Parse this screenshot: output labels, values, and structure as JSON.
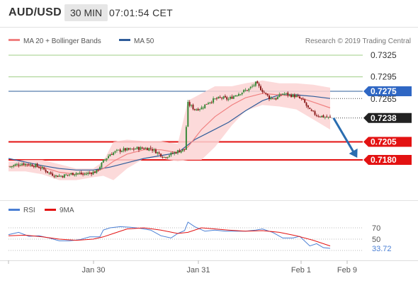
{
  "header": {
    "pair": "AUD/USD",
    "timeframe": "30 MIN",
    "time": "07:01:54 CET"
  },
  "legend": {
    "ma20_label": "MA 20 + Bollinger Bands",
    "ma50_label": "MA 50",
    "credit": "Research © 2019 Trading Central"
  },
  "rsi_legend": {
    "rsi_label": "RSI",
    "ma_label": "9MA"
  },
  "colors": {
    "bullish": "#3a8a3a",
    "bearish": "#8b1c1c",
    "ma20": "#f08080",
    "band_fill": "#fbd3d3",
    "ma50": "#2e5c9a",
    "support": "#e31212",
    "resistance": "#9fce84",
    "arrow": "#2a6db0",
    "rsi": "#4a7fd4",
    "rsi_ma": "#e31212"
  },
  "chart_data": [
    {
      "type": "candlestick",
      "title": "AUD/USD 30 MIN",
      "x_ticks": [
        "Jan 30",
        "Jan 31",
        "Feb 1",
        "Feb 9"
      ],
      "ylim": [
        7145,
        7338
      ],
      "levels": [
        {
          "label": "0.7325",
          "value": 7325,
          "kind": "resistance"
        },
        {
          "label": "0.7295",
          "value": 7295,
          "kind": "resistance"
        },
        {
          "label": "0.7275",
          "value": 7275,
          "kind": "ma50-marker"
        },
        {
          "label": "0.7265",
          "value": 7265,
          "kind": "dotted"
        },
        {
          "label": "0.7238",
          "value": 7238,
          "kind": "last-price"
        },
        {
          "label": "0.7205",
          "value": 7205,
          "kind": "support"
        },
        {
          "label": "0.7180",
          "value": 7180,
          "kind": "support"
        }
      ],
      "close_path": [
        [
          0,
          7170
        ],
        [
          4,
          7173
        ],
        [
          8,
          7175
        ],
        [
          12,
          7174
        ],
        [
          16,
          7172
        ],
        [
          20,
          7168
        ],
        [
          24,
          7162
        ],
        [
          28,
          7158
        ],
        [
          32,
          7158
        ],
        [
          36,
          7160
        ],
        [
          40,
          7162
        ],
        [
          44,
          7160
        ],
        [
          48,
          7162
        ],
        [
          52,
          7164
        ],
        [
          56,
          7178
        ],
        [
          60,
          7188
        ],
        [
          64,
          7192
        ],
        [
          68,
          7194
        ],
        [
          72,
          7194
        ],
        [
          76,
          7196
        ],
        [
          80,
          7196
        ],
        [
          84,
          7196
        ],
        [
          88,
          7190
        ],
        [
          92,
          7184
        ],
        [
          96,
          7188
        ],
        [
          100,
          7192
        ],
        [
          104,
          7194
        ],
        [
          106,
          7258
        ],
        [
          110,
          7250
        ],
        [
          114,
          7252
        ],
        [
          118,
          7260
        ],
        [
          122,
          7264
        ],
        [
          126,
          7266
        ],
        [
          130,
          7264
        ],
        [
          134,
          7270
        ],
        [
          138,
          7274
        ],
        [
          142,
          7278
        ],
        [
          146,
          7286
        ],
        [
          150,
          7276
        ],
        [
          154,
          7266
        ],
        [
          158,
          7265
        ],
        [
          162,
          7272
        ],
        [
          166,
          7270
        ],
        [
          170,
          7268
        ],
        [
          174,
          7262
        ],
        [
          178,
          7248
        ],
        [
          182,
          7242
        ],
        [
          186,
          7240
        ],
        [
          190,
          7238
        ]
      ],
      "ma20_path": [
        [
          0,
          7171
        ],
        [
          10,
          7172
        ],
        [
          20,
          7170
        ],
        [
          30,
          7163
        ],
        [
          40,
          7160
        ],
        [
          50,
          7162
        ],
        [
          56,
          7168
        ],
        [
          62,
          7178
        ],
        [
          70,
          7188
        ],
        [
          80,
          7194
        ],
        [
          90,
          7194
        ],
        [
          100,
          7190
        ],
        [
          106,
          7198
        ],
        [
          114,
          7222
        ],
        [
          122,
          7240
        ],
        [
          132,
          7256
        ],
        [
          140,
          7266
        ],
        [
          150,
          7272
        ],
        [
          160,
          7270
        ],
        [
          170,
          7268
        ],
        [
          180,
          7260
        ],
        [
          190,
          7252
        ]
      ],
      "band_upper": [
        [
          0,
          7178
        ],
        [
          10,
          7180
        ],
        [
          20,
          7180
        ],
        [
          30,
          7174
        ],
        [
          40,
          7168
        ],
        [
          50,
          7168
        ],
        [
          56,
          7178
        ],
        [
          62,
          7205
        ],
        [
          70,
          7208
        ],
        [
          80,
          7206
        ],
        [
          90,
          7206
        ],
        [
          100,
          7202
        ],
        [
          106,
          7262
        ],
        [
          114,
          7272
        ],
        [
          122,
          7282
        ],
        [
          132,
          7282
        ],
        [
          140,
          7286
        ],
        [
          150,
          7290
        ],
        [
          160,
          7286
        ],
        [
          170,
          7286
        ],
        [
          180,
          7284
        ],
        [
          190,
          7280
        ]
      ],
      "band_lower": [
        [
          0,
          7164
        ],
        [
          10,
          7164
        ],
        [
          20,
          7160
        ],
        [
          30,
          7152
        ],
        [
          40,
          7152
        ],
        [
          50,
          7156
        ],
        [
          56,
          7158
        ],
        [
          62,
          7152
        ],
        [
          70,
          7168
        ],
        [
          80,
          7182
        ],
        [
          90,
          7182
        ],
        [
          100,
          7178
        ],
        [
          106,
          7180
        ],
        [
          114,
          7180
        ],
        [
          122,
          7198
        ],
        [
          132,
          7228
        ],
        [
          140,
          7248
        ],
        [
          150,
          7256
        ],
        [
          160,
          7254
        ],
        [
          170,
          7250
        ],
        [
          180,
          7236
        ],
        [
          190,
          7222
        ]
      ],
      "ma50_path": [
        [
          0,
          7182
        ],
        [
          10,
          7177
        ],
        [
          20,
          7172
        ],
        [
          30,
          7168
        ],
        [
          40,
          7166
        ],
        [
          50,
          7166
        ],
        [
          60,
          7170
        ],
        [
          70,
          7176
        ],
        [
          80,
          7182
        ],
        [
          90,
          7186
        ],
        [
          100,
          7190
        ],
        [
          110,
          7208
        ],
        [
          120,
          7220
        ],
        [
          130,
          7232
        ],
        [
          140,
          7248
        ],
        [
          150,
          7262
        ],
        [
          160,
          7270
        ],
        [
          170,
          7270
        ],
        [
          180,
          7268
        ],
        [
          190,
          7265
        ]
      ],
      "forecast_arrow": {
        "from": [
          192,
          7238
        ],
        "to": [
          206,
          7183
        ]
      }
    },
    {
      "type": "line",
      "title": "RSI",
      "ylim": [
        20,
        80
      ],
      "levels": [
        70,
        50,
        30
      ],
      "level_labels": [
        "70",
        "50"
      ],
      "current_label": "33.72",
      "series": [
        {
          "name": "RSI",
          "x": [
            0,
            6,
            12,
            18,
            24,
            30,
            36,
            42,
            48,
            54,
            56,
            60,
            66,
            72,
            78,
            84,
            90,
            96,
            100,
            104,
            106,
            110,
            116,
            122,
            128,
            134,
            140,
            146,
            150,
            156,
            162,
            168,
            172,
            178,
            182,
            186,
            190
          ],
          "values": [
            58,
            62,
            55,
            56,
            52,
            47,
            47,
            49,
            54,
            54,
            66,
            70,
            72,
            71,
            69,
            66,
            56,
            52,
            60,
            65,
            80,
            72,
            64,
            66,
            64,
            64,
            64,
            66,
            68,
            62,
            52,
            52,
            55,
            38,
            42,
            35,
            33.72
          ]
        },
        {
          "name": "9MA",
          "x": [
            0,
            10,
            20,
            30,
            40,
            50,
            56,
            62,
            70,
            80,
            90,
            100,
            106,
            114,
            122,
            130,
            140,
            150,
            160,
            170,
            180,
            190
          ],
          "values": [
            56,
            57,
            54,
            50,
            48,
            50,
            54,
            60,
            68,
            70,
            66,
            60,
            62,
            70,
            68,
            66,
            64,
            65,
            62,
            56,
            48,
            38
          ]
        }
      ]
    }
  ]
}
